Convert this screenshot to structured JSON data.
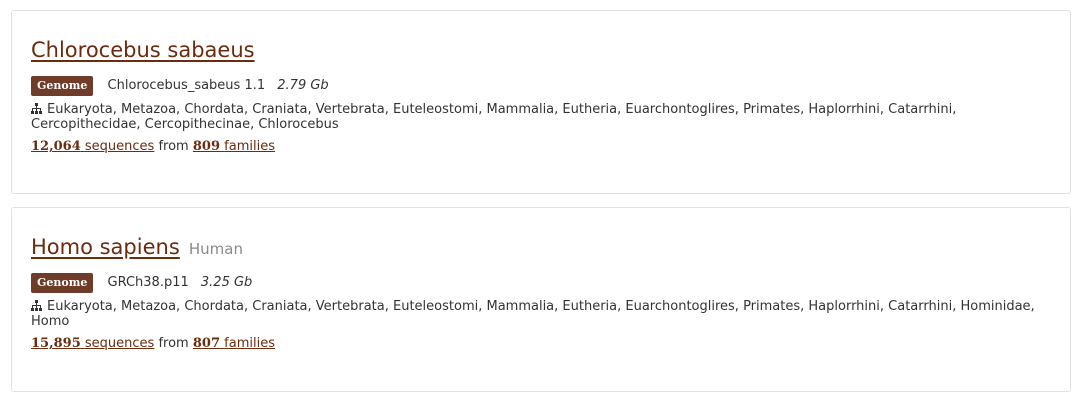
{
  "results": [
    {
      "species": "Chlorocebus sabaeus",
      "common_name": "",
      "badge": "Genome",
      "assembly": "Chlorocebus_sabeus 1.1",
      "size": "2.79 Gb",
      "lineage": "Eukaryota, Metazoa, Chordata, Craniata, Vertebrata, Euteleostomi, Mammalia, Eutheria, Euarchontoglires, Primates, Haplorrhini, Catarrhini, Cercopithecidae, Cercopithecinae, Chlorocebus",
      "lineage_icon": "sitemap-icon",
      "sequences_count": "12,064",
      "sequences_label": "sequences",
      "from_text": "from",
      "families_count": "809",
      "families_label": "families"
    },
    {
      "species": "Homo sapiens",
      "common_name": "Human",
      "badge": "Genome",
      "assembly": "GRCh38.p11",
      "size": "3.25 Gb",
      "lineage": "Eukaryota, Metazoa, Chordata, Craniata, Vertebrata, Euteleostomi, Mammalia, Eutheria, Euarchontoglires, Primates, Haplorrhini, Catarrhini, Hominidae, Homo",
      "lineage_icon": "sitemap-icon",
      "sequences_count": "15,895",
      "sequences_label": "sequences",
      "from_text": "from",
      "families_count": "807",
      "families_label": "families"
    }
  ],
  "colors": {
    "link": "#6a2b0e",
    "badge_bg": "#6f3c2a",
    "muted": "#8a8a8a",
    "text": "#333333",
    "border": "#e2e2e2"
  }
}
